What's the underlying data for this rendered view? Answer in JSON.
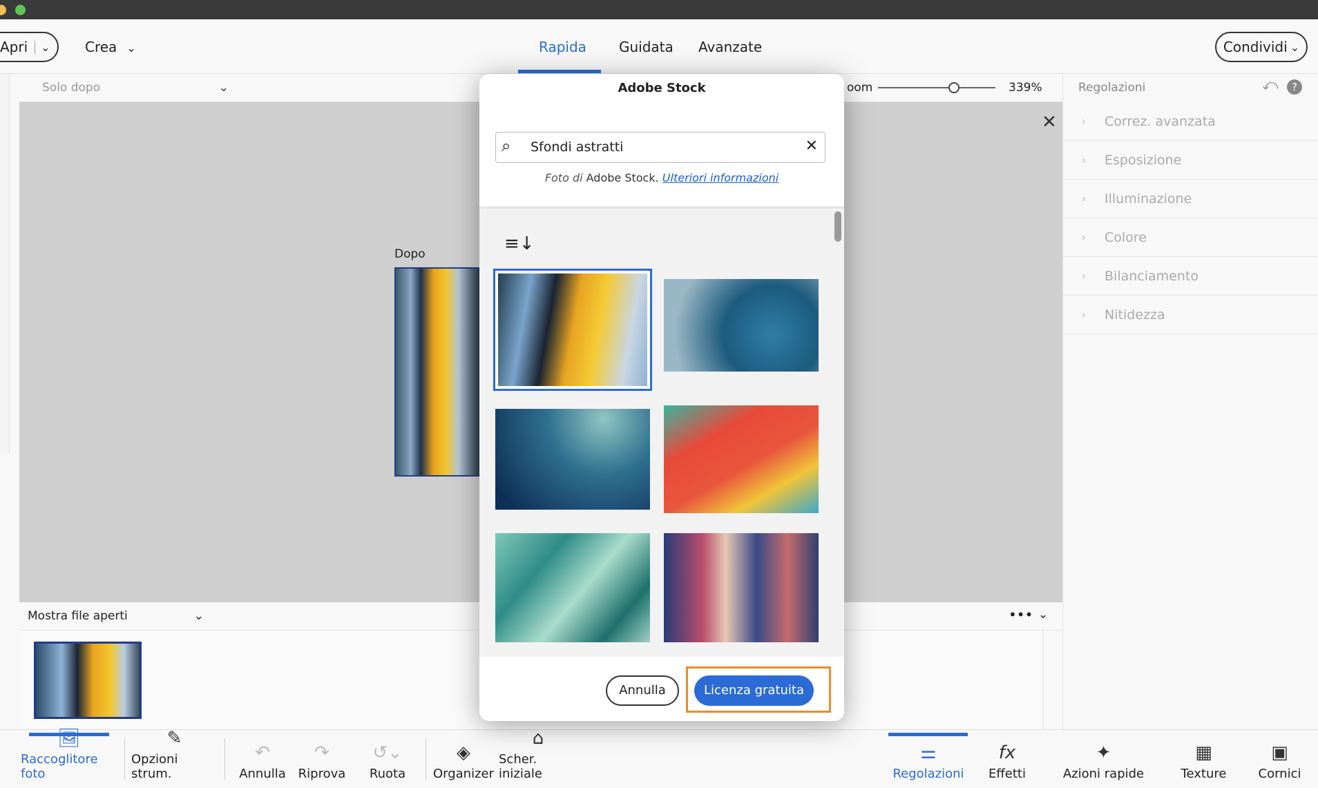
{
  "header": {
    "open": "Apri",
    "create": "Crea",
    "tabs": [
      "Rapida",
      "Guidata",
      "Avanzate"
    ],
    "share": "Condividi"
  },
  "subbar": {
    "view": "Solo dopo",
    "zoom_label": "oom",
    "zoom_value": "339%",
    "zoom_fraction": 0.65
  },
  "canvas": {
    "after_label": "Dopo"
  },
  "right_panel": {
    "title": "Regolazioni",
    "items": [
      "Correz. avanzata",
      "Esposizione",
      "Illuminazione",
      "Colore",
      "Bilanciamento",
      "Nitidezza"
    ]
  },
  "film": {
    "label": "Mostra file aperti"
  },
  "bottom": {
    "items": [
      "Raccoglitore foto",
      "Opzioni strum.",
      "Annulla",
      "Riprova",
      "Ruota",
      "Organizer",
      "Scher. iniziale"
    ],
    "right_items": [
      "Regolazioni",
      "Effetti",
      "Azioni rapide",
      "Texture",
      "Cornici"
    ]
  },
  "dialog": {
    "title": "Adobe Stock",
    "search_value": "Sfondi astratti",
    "credit_prefix": "Foto di ",
    "credit_brand": "Adobe Stock.",
    "credit_link": "Ulteriori informazioni",
    "cancel": "Annulla",
    "license": "Licenza gratuita"
  },
  "colors": {
    "accent": "#2a6bd6",
    "highlight": "#f08a24"
  }
}
